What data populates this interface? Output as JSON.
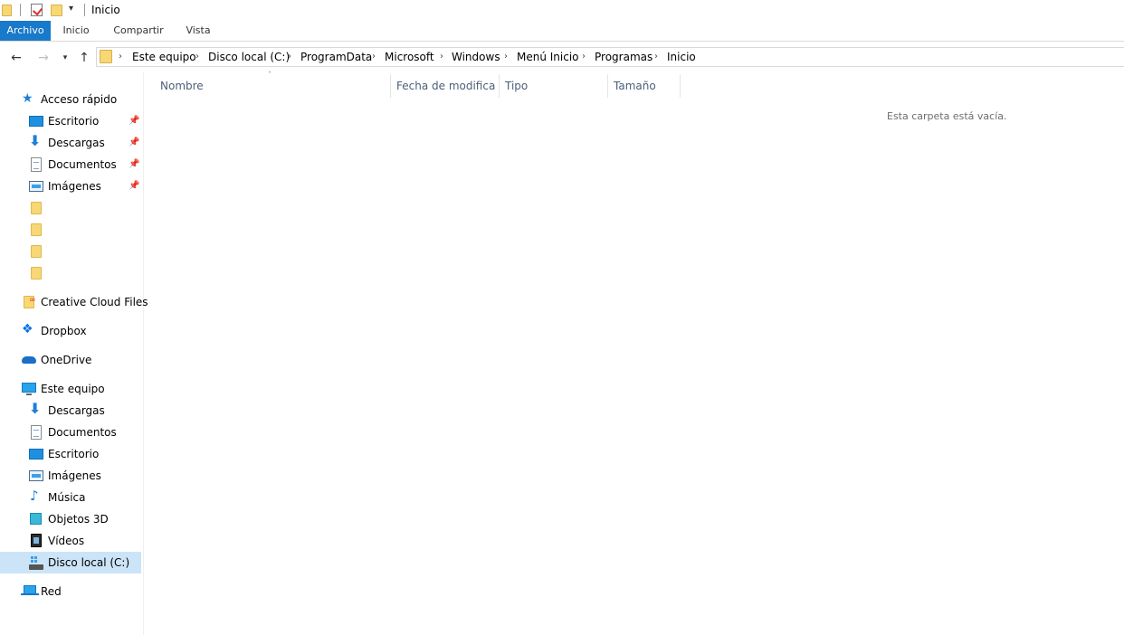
{
  "window": {
    "title": "Inicio"
  },
  "ribbon": {
    "tabs": [
      "Archivo",
      "Inicio",
      "Compartir",
      "Vista"
    ],
    "active_tab": "Archivo",
    "accent": "#1979ca"
  },
  "address": {
    "breadcrumbs": [
      "Este equipo",
      "Disco local (C:)",
      "ProgramData",
      "Microsoft",
      "Windows",
      "Menú Inicio",
      "Programas",
      "Inicio"
    ]
  },
  "columns": [
    "Nombre",
    "Fecha de modifica...",
    "Tipo",
    "Tamaño"
  ],
  "empty_message": "Esta carpeta está vacía.",
  "nav": {
    "quick_access": {
      "label": "Acceso rápido",
      "items": [
        "Escritorio",
        "Descargas",
        "Documentos",
        "Imágenes"
      ]
    },
    "creative_cloud": "Creative Cloud Files",
    "dropbox": "Dropbox",
    "onedrive": "OneDrive",
    "this_pc": {
      "label": "Este equipo",
      "items": [
        "Descargas",
        "Documentos",
        "Escritorio",
        "Imágenes",
        "Música",
        "Objetos 3D",
        "Vídeos",
        "Disco local (C:)"
      ],
      "selected": "Disco local (C:)"
    },
    "network": "Red"
  }
}
